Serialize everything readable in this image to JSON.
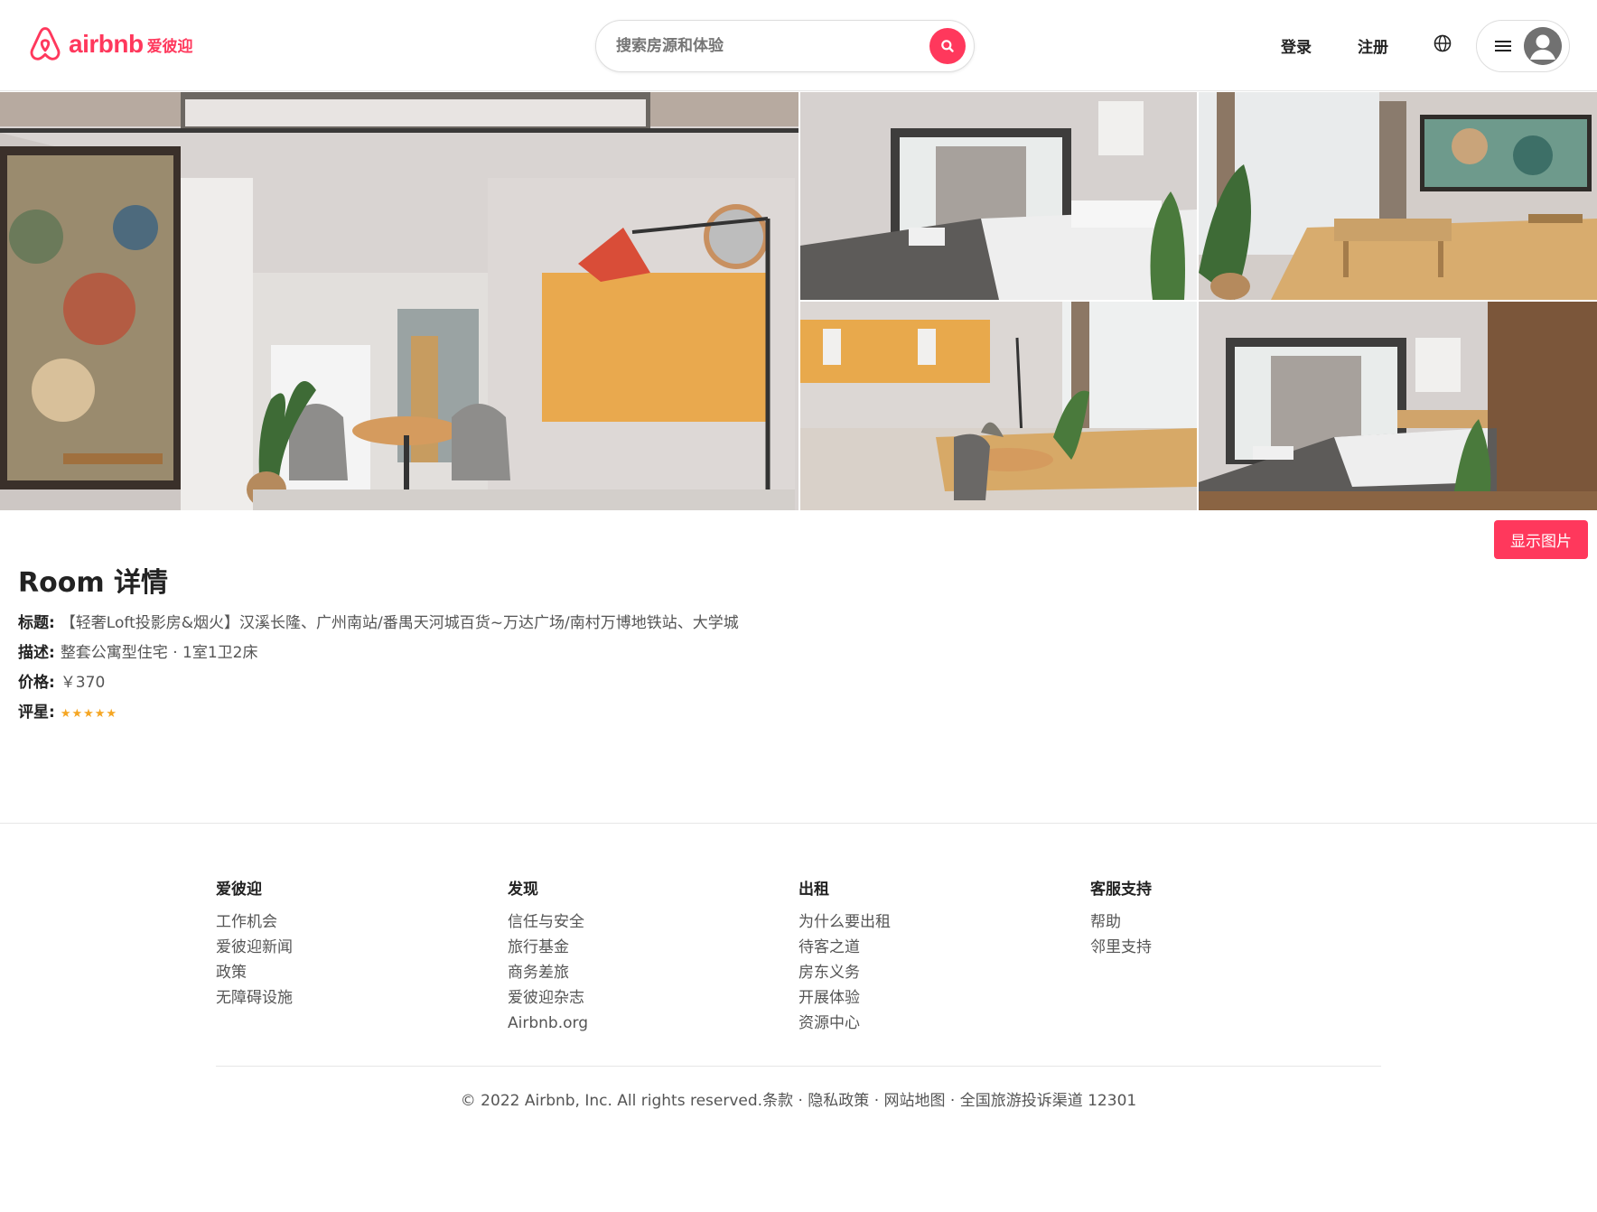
{
  "header": {
    "logo_text": "airbnb",
    "logo_cn": "爱彼迎",
    "search_placeholder": "搜索房源和体验",
    "login": "登录",
    "register": "注册"
  },
  "gallery": {
    "show_photos": "显示图片"
  },
  "details": {
    "heading": "Room 详情",
    "title_label": "标题:",
    "title_value": "【轻奢Loft投影房&烟火】汉溪长隆、广州南站/番禺天河城百货~万达广场/南村万博地铁站、大学城",
    "desc_label": "描述:",
    "desc_value": "整套公寓型住宅 · 1室1卫2床",
    "price_label": "价格:",
    "price_value": "￥370",
    "rating_label": "评星:",
    "rating_value": 5,
    "rating_stars": "★★★★★"
  },
  "footer": {
    "columns": [
      {
        "title": "爱彼迎",
        "links": [
          "工作机会",
          "爱彼迎新闻",
          "政策",
          "无障碍设施"
        ]
      },
      {
        "title": "发现",
        "links": [
          "信任与安全",
          "旅行基金",
          "商务差旅",
          "爱彼迎杂志",
          "Airbnb.org"
        ]
      },
      {
        "title": "出租",
        "links": [
          "为什么要出租",
          "待客之道",
          "房东义务",
          "开展体验",
          "资源中心"
        ]
      },
      {
        "title": "客服支持",
        "links": [
          "帮助",
          "邻里支持"
        ]
      }
    ],
    "copyright": "© 2022 Airbnb, Inc. All rights reserved.条款 · 隐私政策 · 网站地图 · 全国旅游投诉渠道 12301"
  },
  "colors": {
    "brand": "#ff385c",
    "star": "#f5a623"
  }
}
